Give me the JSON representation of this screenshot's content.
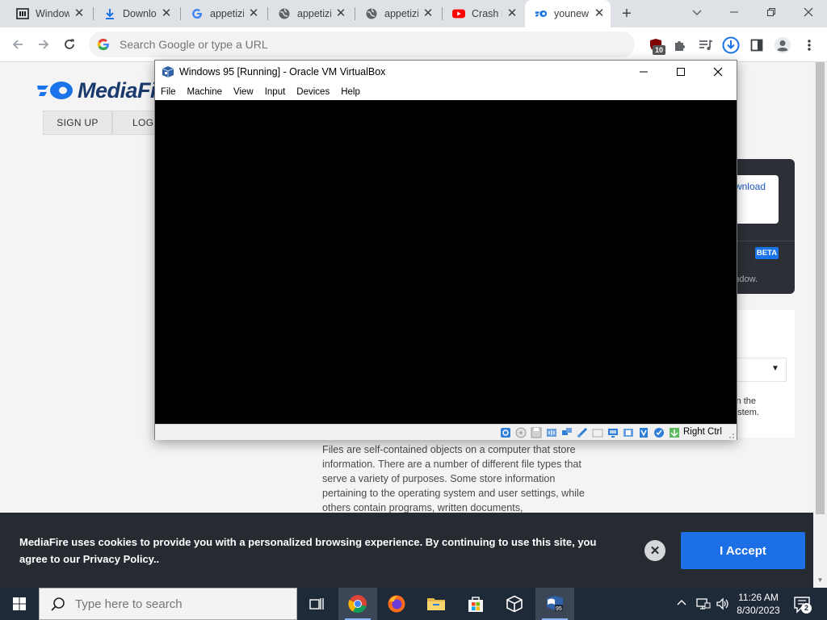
{
  "browser": {
    "tabs": [
      {
        "label": "Window",
        "icon": "archive-icon"
      },
      {
        "label": "Downlo",
        "icon": "download-icon"
      },
      {
        "label": "appetizi",
        "icon": "google-icon"
      },
      {
        "label": "appetizi",
        "icon": "globe-icon"
      },
      {
        "label": "appetizi",
        "icon": "globe-icon"
      },
      {
        "label": "Crash K",
        "icon": "youtube-icon"
      },
      {
        "label": "younew",
        "icon": "mediafire-icon"
      }
    ],
    "active_tab_index": 6,
    "omnibox_placeholder": "Search Google or type a URL",
    "extension_badge": "10"
  },
  "mediafire": {
    "logo_text": "MediaFi",
    "signup_label": "SIGN UP",
    "login_label": "LOG I",
    "download_fragment": "wnload",
    "beta_badge": "BETA",
    "window_fragment": "ndow.",
    "the_fragment": "n the",
    "system_fragment": "stem.",
    "article_text": "Files are self-contained objects on a computer that store information. There are a number of different file types that serve a variety of purposes. Some store information pertaining to the operating system and user settings, while others contain programs, written documents,",
    "cookie_text": "MediaFire uses cookies to provide you with a personalized browsing experience. By continuing to use this site, you agree to our Privacy Policy..",
    "accept_label": "I Accept",
    "close_symbol": "✕"
  },
  "vbox": {
    "title": "Windows 95 [Running] - Oracle VM VirtualBox",
    "menu": [
      "File",
      "Machine",
      "View",
      "Input",
      "Devices",
      "Help"
    ],
    "host_key": "Right Ctrl"
  },
  "taskbar": {
    "search_placeholder": "Type here to search",
    "time": "11:26 AM",
    "date": "8/30/2023",
    "notification_count": "2"
  },
  "colors": {
    "accent": "#1d6fe5",
    "cookie_bg": "#262a31",
    "taskbar_bg": "#1f2a38"
  }
}
